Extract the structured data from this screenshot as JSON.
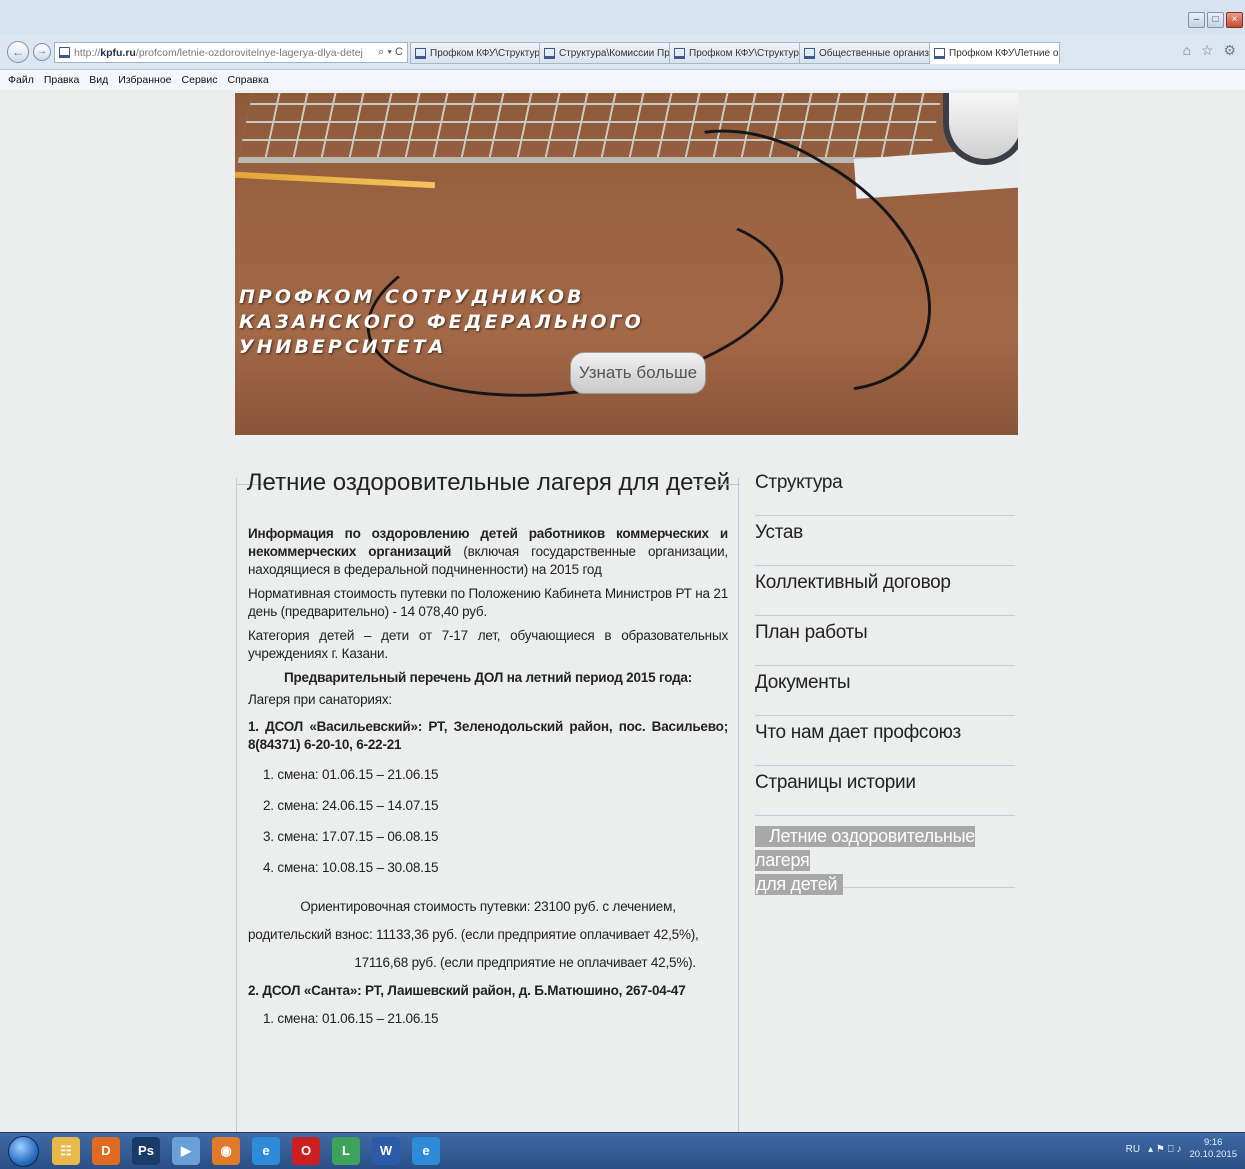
{
  "browser": {
    "url_prefix": "http://",
    "url_host": "kpfu.ru",
    "url_path": "/profcom/letnie-ozdorovitelnye-lagerya-dlya-detej",
    "addr_tools": "⌕ ▾ C",
    "tabs": [
      {
        "label": "Профком КФУ\\Структура - К..."
      },
      {
        "label": "Структура\\Комиссии Профк..."
      },
      {
        "label": "Профком КФУ\\Структура - К..."
      },
      {
        "label": "Общественные организации..."
      },
      {
        "label": "Профком КФУ\\Летние озд...",
        "close": "×"
      }
    ],
    "nav_icons": "⌂ ☆ ⚙",
    "window_controls": [
      "–",
      "□",
      "×"
    ],
    "menu": [
      "Файл",
      "Правка",
      "Вид",
      "Избранное",
      "Сервис",
      "Справка"
    ]
  },
  "banner": {
    "title_lines": [
      "ПРОФКОМ СОТРУДНИКОВ",
      "КАЗАНСКОГО ФЕДЕРАЛЬНОГО",
      "УНИВЕРСИТЕТА"
    ],
    "button_label": "Узнать больше"
  },
  "article": {
    "title": "Летние оздоровительные лагеря для детей",
    "intro_bold": "Информация по оздоровлению детей работников коммерческих и некоммерческих организаций",
    "intro_rest": " (включая государственные организации, находящиеся в федеральной подчиненности) на 2015 год",
    "normative_cost": "Нормативная стоимость путевки по Положению Кабинета Министров РТ на 21 день (предварительно) - 14 078,40 руб.",
    "category": "Категория детей – дети от 7-17 лет, обучающиеся в образовательных учреждениях г. Казани.",
    "list_heading": "Предварительный перечень ДОЛ на летний период 2015 года:",
    "sanatorium_label": "Лагеря при санаториях:",
    "camp1": "1. ДСОЛ «Васильевский»: РТ, Зеленодольский район, пос. Васильево; 8(84371) 6-20-10, 6-22-21",
    "camp1_shifts": [
      "1.  смена: 01.06.15 – 21.06.15",
      "2.  смена: 24.06.15 – 14.07.15",
      "3.  смена: 17.07.15 – 06.08.15",
      "4.  смена: 10.08.15 – 30.08.15"
    ],
    "cost_line1": "Ориентировочная стоимость путевки: 23100 руб. с лечением,",
    "cost_line2": "родительский взнос: 11133,36 руб. (если предприятие оплачивает 42,5%),",
    "cost_line3": "17116,68 руб. (если предприятие не оплачивает 42,5%).",
    "camp2": "2. ДСОЛ «Санта»: РТ, Лаишевский район, д. Б.Матюшино, 267-04-47",
    "camp2_shifts": [
      "1.  смена: 01.06.15 – 21.06.15"
    ]
  },
  "sidebar": {
    "items": [
      {
        "label": "Структура"
      },
      {
        "label": "Устав"
      },
      {
        "label": "Коллективный договор"
      },
      {
        "label": "План работы"
      },
      {
        "label": "Документы"
      },
      {
        "label": "Что нам дает профсоюз"
      },
      {
        "label": "Страницы истории"
      }
    ],
    "active_line1": "Летние оздоровительные лагеря",
    "active_line2": "для детей"
  },
  "taskbar": {
    "apps": [
      {
        "icon": "file-explorer-icon",
        "glyph": "☷",
        "color": "#e8b84a"
      },
      {
        "icon": "app-orange-icon",
        "glyph": "D",
        "color": "#e06b1f"
      },
      {
        "icon": "photoshop-icon",
        "glyph": "Ps",
        "color": "#1a3a6a"
      },
      {
        "icon": "media-player-icon",
        "glyph": "▶",
        "color": "#6aa0d8"
      },
      {
        "icon": "firefox-icon",
        "glyph": "◉",
        "color": "#e0792a"
      },
      {
        "icon": "internet-explorer-icon",
        "glyph": "e",
        "color": "#2e8bd8"
      },
      {
        "icon": "opera-icon",
        "glyph": "O",
        "color": "#cc1f1f"
      },
      {
        "icon": "app-green-icon",
        "glyph": "L",
        "color": "#3ea35a"
      },
      {
        "icon": "word-icon",
        "glyph": "W",
        "color": "#2b5aa8"
      },
      {
        "icon": "internet-explorer-icon",
        "glyph": "e",
        "color": "#2e8bd8"
      }
    ],
    "language": "RU",
    "tray_icons": "▴ ⚑ ⎕ ♪",
    "time": "9:16",
    "date": "20.10.2015"
  },
  "colors": {
    "page_bg": "#eceeed",
    "accent_line": "#b9ccdc",
    "active_menu_bg": "#a8a8a8",
    "taskbar": "#2a4f86"
  }
}
